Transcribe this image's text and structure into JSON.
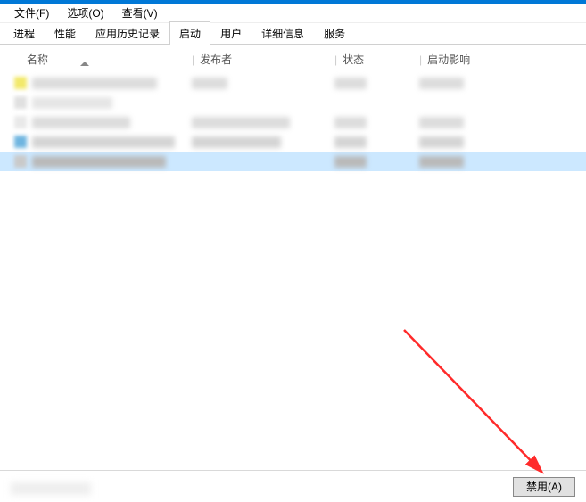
{
  "menubar": {
    "file": "文件(F)",
    "options": "选项(O)",
    "view": "查看(V)"
  },
  "tabs": {
    "processes": "进程",
    "performance": "性能",
    "history": "应用历史记录",
    "startup": "启动",
    "users": "用户",
    "details": "详细信息",
    "services": "服务",
    "active_index": 3
  },
  "columns": {
    "name": "名称",
    "publisher": "发布者",
    "status": "状态",
    "impact": "启动影响"
  },
  "rows": [
    {
      "icon": "#f2e96b",
      "name_w": 140,
      "pub_w": 40,
      "stat_w": 36,
      "imp_w": 50,
      "selected": false,
      "shade": "#dcdcdc"
    },
    {
      "icon": "#e0e0e0",
      "name_w": 90,
      "pub_w": 0,
      "stat_w": 0,
      "imp_w": 0,
      "selected": false,
      "shade": "#e5e5e5"
    },
    {
      "icon": "#e9e9e9",
      "name_w": 110,
      "pub_w": 110,
      "stat_w": 36,
      "imp_w": 50,
      "selected": false,
      "shade": "#dcdcdc"
    },
    {
      "icon": "#6fb5e0",
      "name_w": 160,
      "pub_w": 100,
      "stat_w": 36,
      "imp_w": 50,
      "selected": false,
      "shade": "#d4d4d4"
    },
    {
      "icon": "#c9c9c9",
      "name_w": 150,
      "pub_w": 0,
      "stat_w": 36,
      "imp_w": 50,
      "selected": true,
      "shade": "#b9b9b9"
    }
  ],
  "footer": {
    "disable": "禁用(A)"
  }
}
